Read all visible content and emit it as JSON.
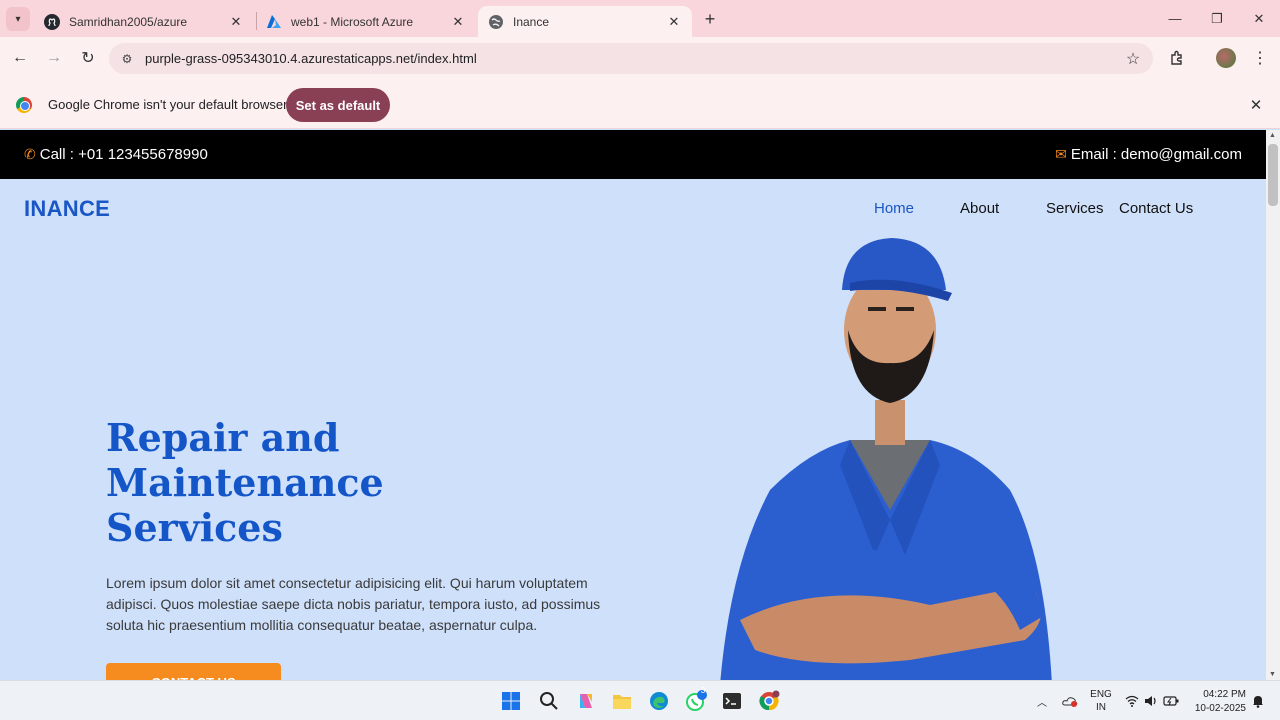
{
  "browser": {
    "tabs": [
      {
        "title": "Samridhan2005/azure",
        "icon": "github-icon",
        "active": false
      },
      {
        "title": "web1 - Microsoft Azure",
        "icon": "azure-icon",
        "active": false
      },
      {
        "title": "Inance",
        "icon": "globe-icon",
        "active": true
      }
    ],
    "url": "purple-grass-095343010.4.azurestaticapps.net/index.html",
    "infobar": {
      "message": "Google Chrome isn't your default browser",
      "button": "Set as default"
    }
  },
  "site": {
    "topbar": {
      "call": "Call : +01 123455678990",
      "email": "Email : demo@gmail.com"
    },
    "brand": "INANCE",
    "nav": [
      "Home",
      "About",
      "Services",
      "Contact Us"
    ],
    "active_nav": "Home",
    "hero": {
      "title": "Repair and Maintenance Services",
      "text": "Lorem ipsum dolor sit amet consectetur adipisicing elit. Qui harum voluptatem adipisci. Quos molestiae saepe dicta nobis pariatur, tempora iusto, ad possimus soluta hic praesentium mollitia consequatur beatae, aspernatur culpa.",
      "button": "CONTACT US"
    },
    "colors": {
      "brand": "#1a56c4",
      "accent": "#f68b1f",
      "background": "#cfe0fb"
    }
  },
  "taskbar": {
    "language": "ENG",
    "region": "IN",
    "time": "04:22 PM",
    "date": "10-02-2025",
    "whatsapp_badge": "3"
  }
}
